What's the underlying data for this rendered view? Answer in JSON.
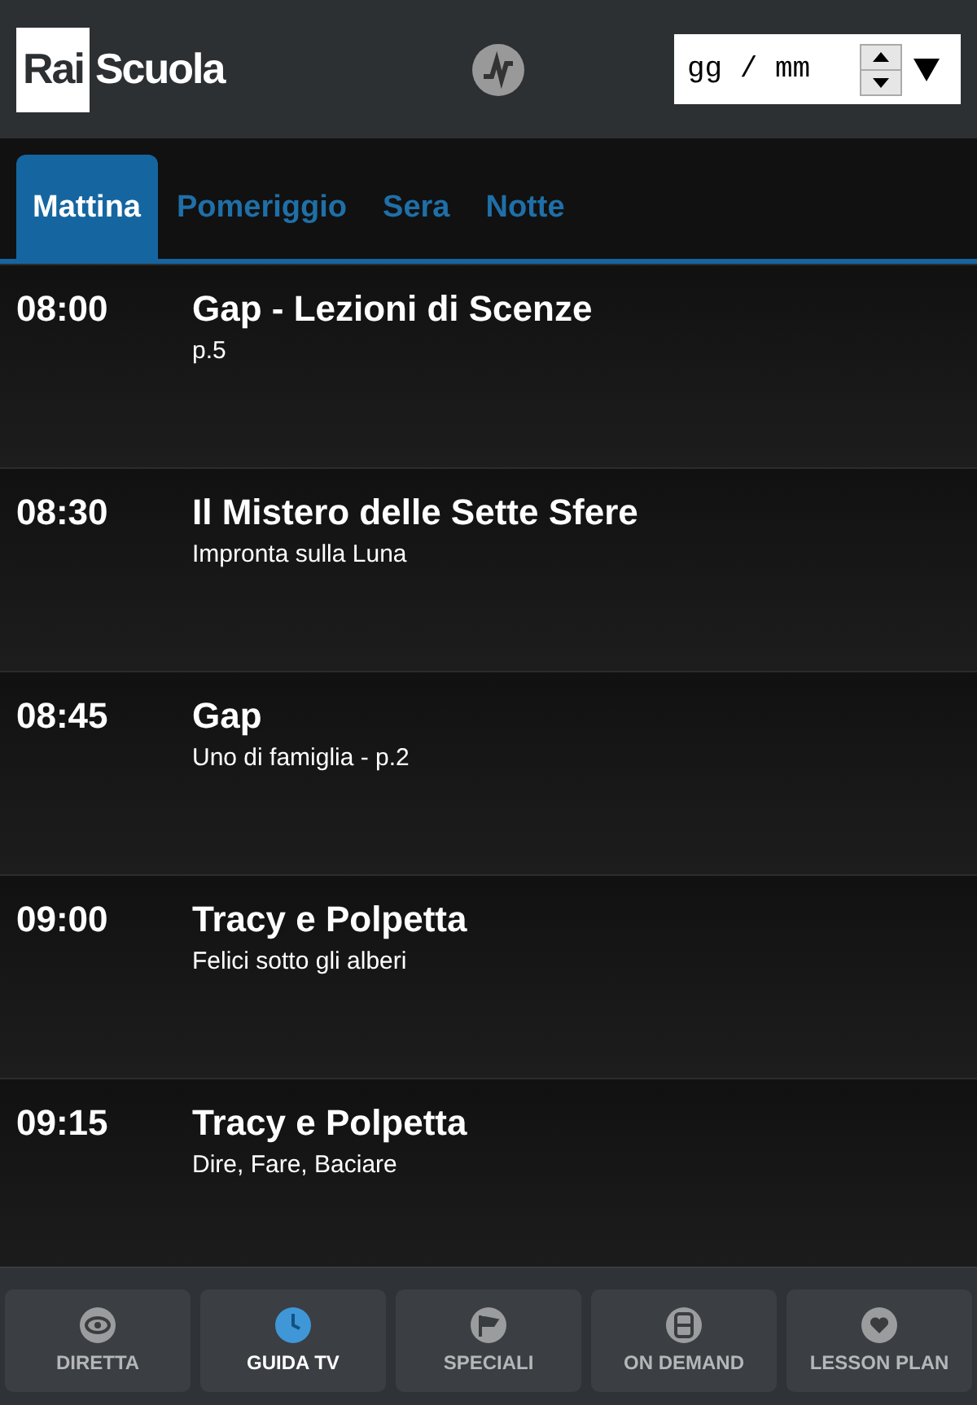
{
  "header": {
    "logo": {
      "box_text": "Rai",
      "text": "Scuola"
    },
    "date_field": {
      "placeholder": "gg / mm"
    }
  },
  "tabs": [
    {
      "label": "Mattina",
      "selected": true
    },
    {
      "label": "Pomeriggio",
      "selected": false
    },
    {
      "label": "Sera",
      "selected": false
    },
    {
      "label": "Notte",
      "selected": false
    }
  ],
  "schedule": [
    {
      "time": "08:00",
      "title": "Gap - Lezioni di Scenze",
      "subtitle": "p.5"
    },
    {
      "time": "08:30",
      "title": "Il Mistero delle Sette Sfere",
      "subtitle": "Impronta sulla Luna"
    },
    {
      "time": "08:45",
      "title": "Gap",
      "subtitle": "Uno di famiglia - p.2"
    },
    {
      "time": "09:00",
      "title": "Tracy e Polpetta",
      "subtitle": "Felici sotto gli alberi"
    },
    {
      "time": "09:15",
      "title": "Tracy e Polpetta",
      "subtitle": "Dire, Fare, Baciare"
    }
  ],
  "bottom_nav": [
    {
      "label": "DIRETTA",
      "kind": "eye",
      "selected": false
    },
    {
      "label": "GUIDA TV",
      "kind": "clock",
      "selected": true
    },
    {
      "label": "SPECIALI",
      "kind": "flag",
      "selected": false
    },
    {
      "label": "ON DEMAND",
      "kind": "film",
      "selected": false
    },
    {
      "label": "LESSON PLAN",
      "kind": "heart",
      "selected": false
    }
  ]
}
